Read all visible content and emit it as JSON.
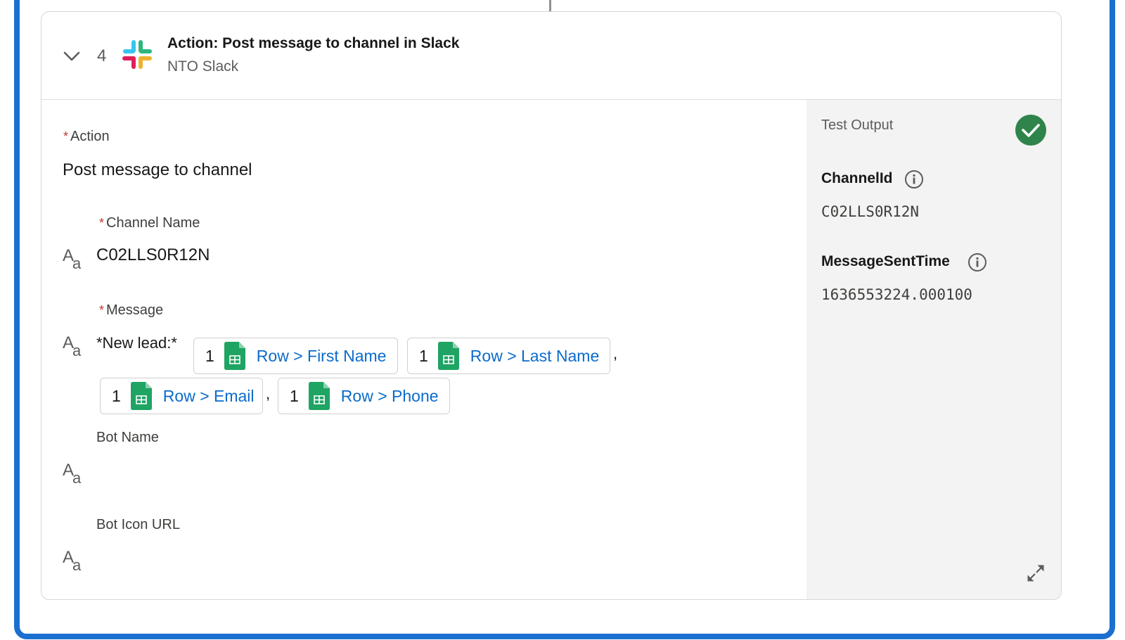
{
  "step": {
    "number": "4",
    "title": "Action: Post message to channel in Slack",
    "subtitle": "NTO Slack"
  },
  "form": {
    "action": {
      "label": "Action",
      "required": "*",
      "value": "Post message to channel"
    },
    "channel_name": {
      "label": "Channel Name",
      "required": "*",
      "value": "C02LLS0R12N"
    },
    "message": {
      "label": "Message",
      "required": "*",
      "prefix": "*New lead:*",
      "pills": [
        {
          "num": "1",
          "ref": "Row > First Name"
        },
        {
          "num": "1",
          "ref": "Row > Last Name"
        },
        {
          "num": "1",
          "ref": "Row > Email"
        },
        {
          "num": "1",
          "ref": "Row > Phone"
        }
      ],
      "separator": ","
    },
    "bot_name": {
      "label": "Bot Name",
      "value": ""
    },
    "bot_icon_url": {
      "label": "Bot Icon URL",
      "value": ""
    },
    "text_type_icon": {
      "upper": "A",
      "lower": "a"
    }
  },
  "test_output": {
    "title": "Test Output",
    "status": "success",
    "fields": [
      {
        "name": "ChannelId",
        "value": "C02LLS0R12N"
      },
      {
        "name": "MessageSentTime",
        "value": "1636553224.000100"
      }
    ]
  },
  "colors": {
    "frame_border": "#1b6fd0",
    "link": "#0b6bcb",
    "required": "#c23934",
    "success": "#2e844a",
    "sheets_green": "#1fa463",
    "output_bg": "#f3f3f3"
  }
}
